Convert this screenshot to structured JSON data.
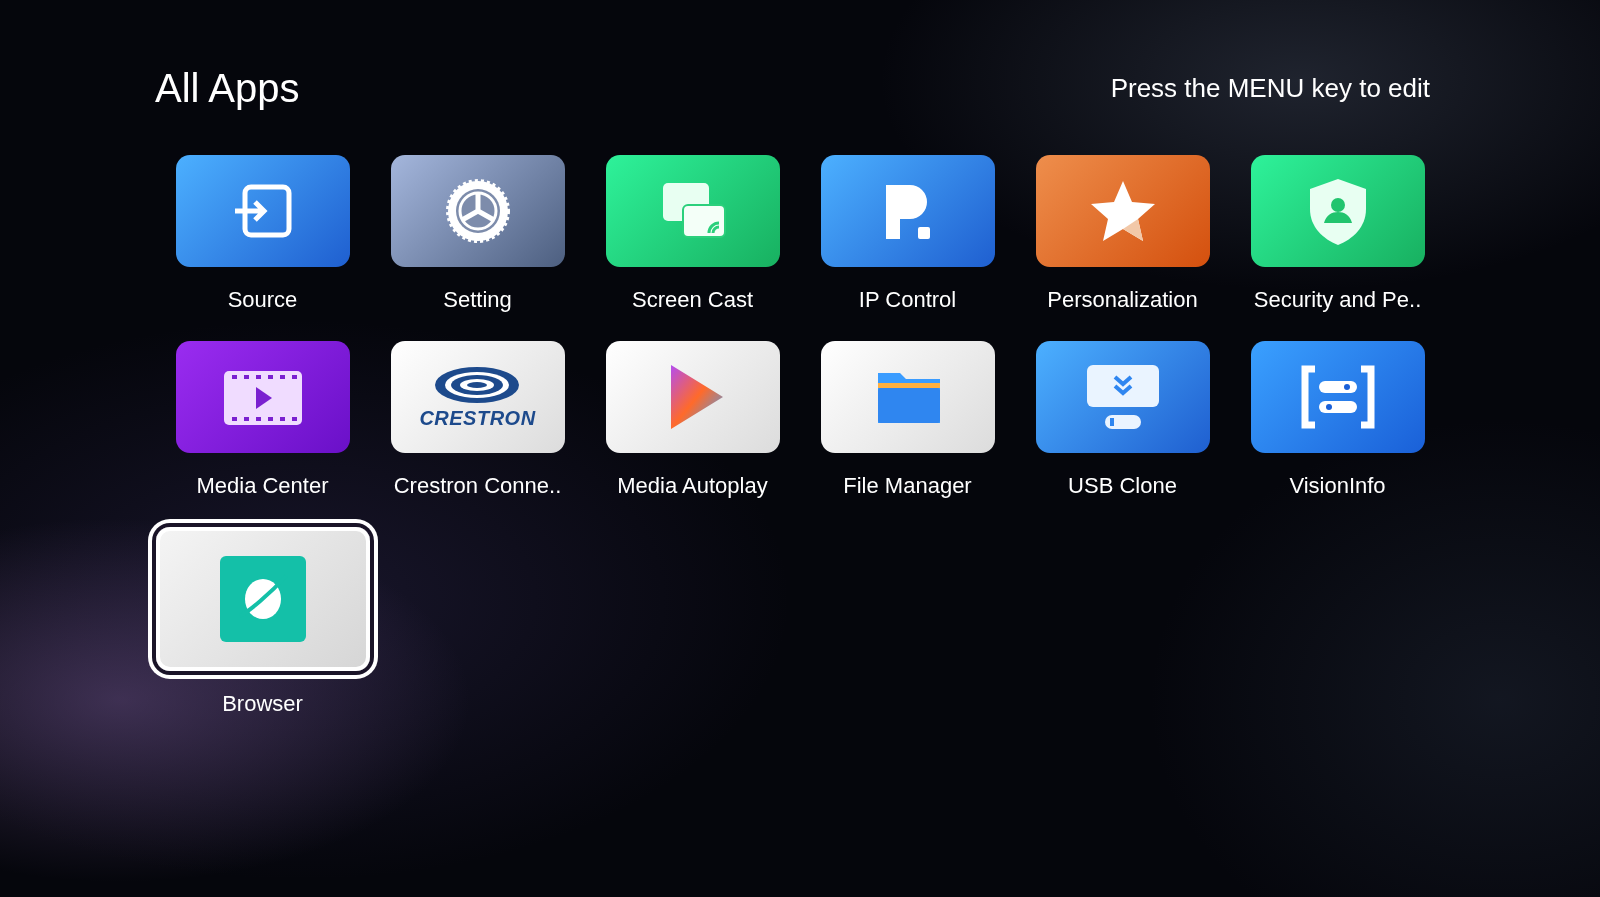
{
  "header": {
    "title": "All Apps",
    "hint": "Press the MENU key to edit"
  },
  "apps": [
    {
      "name": "Source",
      "kind": "source",
      "selected": false
    },
    {
      "name": "Setting",
      "kind": "setting",
      "selected": false
    },
    {
      "name": "Screen Cast",
      "kind": "cast",
      "selected": false
    },
    {
      "name": "IP Control",
      "kind": "ipcontrol",
      "selected": false
    },
    {
      "name": "Personalization",
      "kind": "personal",
      "selected": false
    },
    {
      "name": "Security and Pe..",
      "kind": "security",
      "selected": false
    },
    {
      "name": "Media Center",
      "kind": "media",
      "selected": false
    },
    {
      "name": "Crestron Conne..",
      "kind": "crestron",
      "selected": false,
      "logo_text": "CRESTRON"
    },
    {
      "name": "Media Autoplay",
      "kind": "autoplay",
      "selected": false
    },
    {
      "name": "File Manager",
      "kind": "files",
      "selected": false
    },
    {
      "name": "USB Clone",
      "kind": "usb",
      "selected": false
    },
    {
      "name": "VisionInfo",
      "kind": "vision",
      "selected": false
    },
    {
      "name": "Browser",
      "kind": "browser",
      "selected": true
    }
  ]
}
